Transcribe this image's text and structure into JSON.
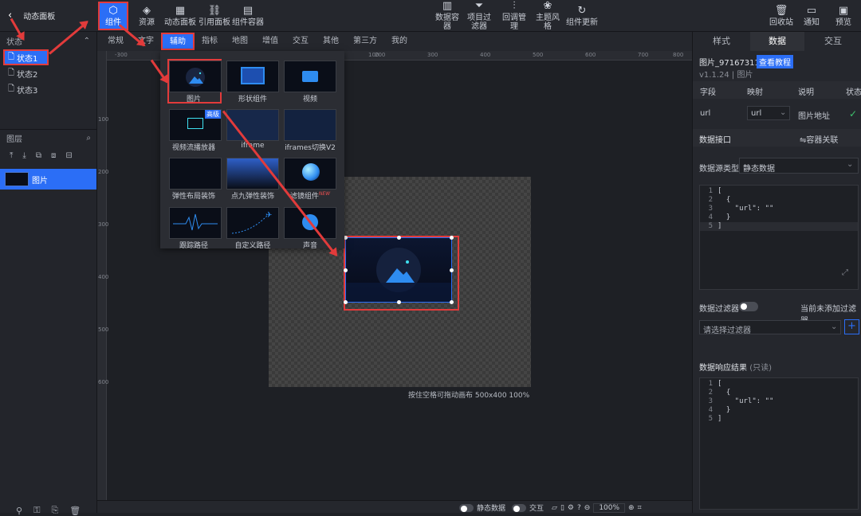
{
  "header": {
    "back_icon": "chevron-left-icon",
    "title": "动态面板",
    "left_buttons": [
      {
        "label": "组件",
        "icon": "component-icon"
      },
      {
        "label": "资源",
        "icon": "layers-icon"
      },
      {
        "label": "动态面板",
        "icon": "grid-icon"
      },
      {
        "label": "引用面板",
        "icon": "link-icon"
      },
      {
        "label": "组件容器",
        "icon": "doc-icon"
      }
    ],
    "center_buttons": [
      {
        "label": "数据容器",
        "icon": "chart-icon"
      },
      {
        "label": "项目过滤器",
        "icon": "filter-icon"
      },
      {
        "label": "回调管理",
        "icon": "sliders-icon"
      },
      {
        "label": "主题风格",
        "icon": "theme-icon"
      },
      {
        "label": "组件更新",
        "icon": "refresh-icon"
      }
    ],
    "right_buttons": [
      {
        "label": "回收站",
        "icon": "trash-icon"
      },
      {
        "label": "通知",
        "icon": "message-icon"
      },
      {
        "label": "预览",
        "icon": "monitor-icon"
      }
    ]
  },
  "left_panel": {
    "states_title": "状态",
    "states": [
      "状态1",
      "状态2",
      "状态3"
    ],
    "layers_title": "图层",
    "layers": [
      "图片"
    ]
  },
  "category_tabs": [
    "常规",
    "文字",
    "辅助",
    "指标",
    "地图",
    "增值",
    "交互",
    "其他",
    "第三方",
    "我的"
  ],
  "dropdown": {
    "items": [
      {
        "label": "图片",
        "badge": ""
      },
      {
        "label": "形状组件",
        "badge": ""
      },
      {
        "label": "视频",
        "badge": ""
      },
      {
        "label": "视频流播放器",
        "badge": "高级"
      },
      {
        "label": "iframe",
        "badge": ""
      },
      {
        "label": "iframes切换V2",
        "badge": ""
      },
      {
        "label": "弹性布局装饰",
        "badge": ""
      },
      {
        "label": "点九弹性装饰",
        "badge": ""
      },
      {
        "label": "滤镜组件",
        "badge": "NEW"
      },
      {
        "label": "跟踪路径",
        "badge": ""
      },
      {
        "label": "自定义路径",
        "badge": ""
      },
      {
        "label": "声音",
        "badge": ""
      }
    ]
  },
  "ruler": {
    "top": [
      "-300",
      "100",
      "200",
      "300",
      "400",
      "500",
      "600",
      "700",
      "800"
    ],
    "left": [
      "100",
      "200",
      "300",
      "400",
      "500",
      "600"
    ]
  },
  "canvas": {
    "status": "按住空格可拖动画布  500x400 100%"
  },
  "right_panel": {
    "tabs": [
      "样式",
      "数据",
      "交互"
    ],
    "component_name": "图片_97167311",
    "tutorial": "查看教程",
    "version": "v1.1.24 | 图片",
    "table_headers": [
      "字段",
      "映射",
      "说明",
      "状态"
    ],
    "row": {
      "field": "url",
      "mapping": "url",
      "desc": "图片地址"
    },
    "interface_title": "数据接口",
    "container_link": "⇋容器关联",
    "source_type_label": "数据源类型",
    "source_type_value": "静态数据",
    "code_lines": [
      "[",
      "  {",
      "    \"url\": \"\"",
      "  }",
      "]"
    ],
    "filter_label": "数据过滤器",
    "filter_hint": "当前未添加过滤器",
    "filter_placeholder": "请选择过滤器",
    "result_title": "数据响应结果",
    "result_readonly": "(只读)",
    "result_lines": [
      "[",
      "  {",
      "    \"url\": \"\"",
      "  }",
      "]"
    ]
  },
  "bottom": {
    "static_data": "静态数据",
    "interaction": "交互",
    "zoom": "100%"
  }
}
